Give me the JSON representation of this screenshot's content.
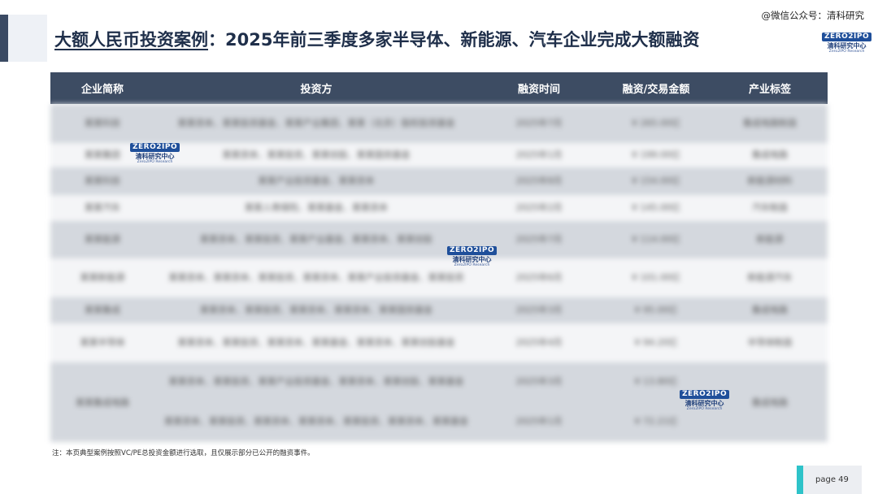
{
  "header": {
    "title_highlight": "大额人民币投资案例",
    "title_rest": "：2025年前三季度多家半导体、新能源、汽车企业完成大额融资",
    "watermark": "@微信公众号：清科研究"
  },
  "logo": {
    "badge": "ZERO2IPO",
    "cn": "清科研究中心",
    "en": "Zero2IPO Research"
  },
  "table": {
    "headers": [
      "企业简称",
      "投资方",
      "融资时间",
      "融资/交易金额",
      "产业标签"
    ],
    "rows": [
      {
        "company": "某某科技",
        "investors": "某某资本、某某投资基金、某某产业集团、某某（北京）股权投资基金",
        "date": "2025年7月",
        "amount": "¥ 265.00亿",
        "tag": "集成电路制造"
      },
      {
        "company": "某某集团",
        "investors": "某某资本、某某投资、某某创投、某某国资基金",
        "date": "2025年1月",
        "amount": "¥ 199.00亿",
        "tag": "集成电路"
      },
      {
        "company": "某某科技",
        "investors": "某某产业投资基金、某某资本",
        "date": "2025年8月",
        "amount": "¥ 154.00亿",
        "tag": "新能源材料"
      },
      {
        "company": "某某汽车",
        "investors": "某某人寿保险、某某基金、某某资本",
        "date": "2025年2月",
        "amount": "¥ 145.00亿",
        "tag": "汽车制造"
      },
      {
        "company": "某某能源",
        "investors": "某某资本、某某投资、某某产业基金、某某资本、某某创投",
        "date": "2025年7月",
        "amount": "¥ 114.00亿",
        "tag": "新能源"
      },
      {
        "company": "某某新能源",
        "investors": "某某资本、某某资本、某某投资、某某资本、某某产业投资基金、某某投资",
        "date": "2025年6月",
        "amount": "¥ 101.00亿",
        "tag": "新能源汽车"
      },
      {
        "company": "某某集成",
        "investors": "某某资本、某某投资、某某资本、某某资本、某某国资基金",
        "date": "2025年3月",
        "amount": "¥ 95.00亿",
        "tag": "集成电路"
      },
      {
        "company": "某某半导体",
        "investors": "某某资本、某某投资、某某资本、某某基金、某某资本、某某创投基金",
        "date": "2025年4月",
        "amount": "¥ 94.20亿",
        "tag": "半导体制造"
      }
    ],
    "merged_row": {
      "company": "某某集成电路",
      "tag": "集成电路",
      "sub": [
        {
          "investors": "某某资本、某某投资、某某产业投资基金、某某资本、某某创投、某某基金",
          "date": "2025年3月",
          "amount": "¥ 13.80亿"
        },
        {
          "investors": "某某资本、某某投资、某某资本、某某资本、某某投资、某某资本、某某基金",
          "date": "2025年1月",
          "amount": "¥ 72.21亿"
        }
      ]
    }
  },
  "note": "注：本页典型案例按照VC/PE总投资金额进行选取，且仅展示部分已公开的融资事件。",
  "page": "page  49"
}
